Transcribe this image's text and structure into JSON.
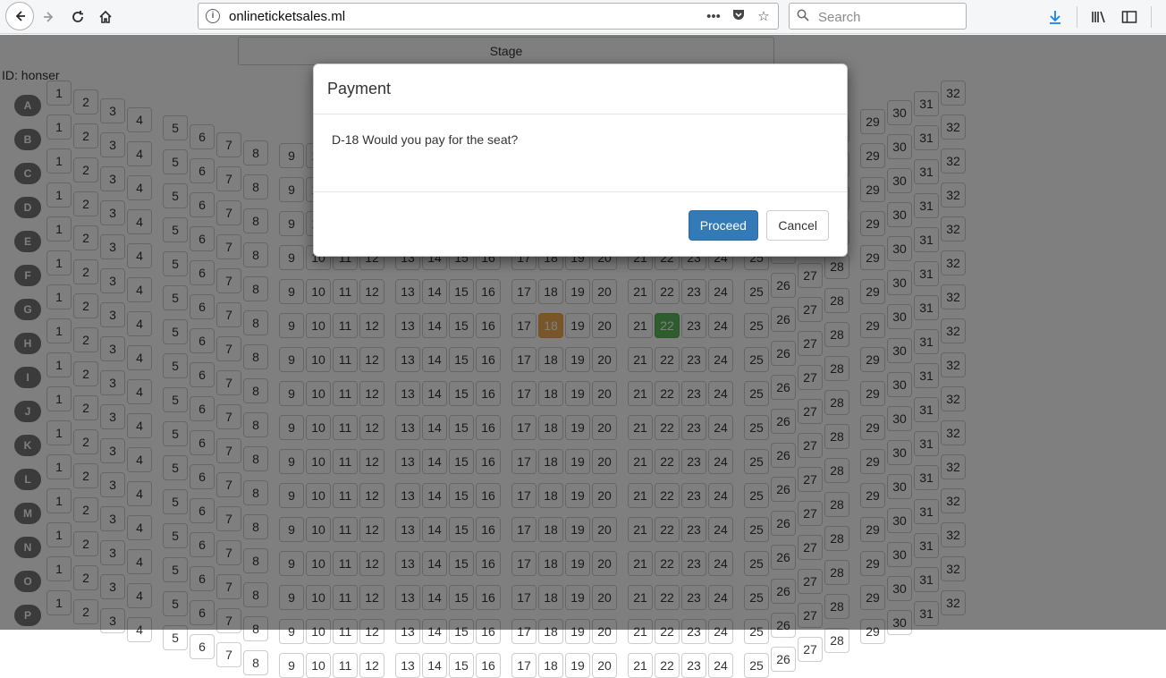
{
  "browser": {
    "url": "onlineticketsales.ml",
    "search_placeholder": "Search",
    "icons": [
      "back-icon",
      "forward-icon",
      "reload-icon",
      "home-icon",
      "info-icon",
      "page-actions-icon",
      "pocket-icon",
      "bookmark-star-icon",
      "download-icon",
      "library-icon",
      "sidebar-icon",
      "menu-icon"
    ]
  },
  "page": {
    "stage_label": "Stage",
    "user_id": "ID: honser"
  },
  "seatmap": {
    "rows": [
      "A",
      "B",
      "C",
      "D",
      "E",
      "F",
      "G",
      "H",
      "I",
      "J",
      "K",
      "L",
      "M",
      "N",
      "O",
      "P"
    ],
    "seat_count": 32,
    "selected": [
      {
        "row": "F",
        "seat": 18,
        "status": "sold"
      },
      {
        "row": "F",
        "seat": 22,
        "status": "reserved"
      }
    ]
  },
  "modal": {
    "title": "Payment",
    "message": "D-18 Would you pay for the seat?",
    "proceed_label": "Proceed",
    "cancel_label": "Cancel"
  },
  "colors": {
    "sold": "#f0ad4e",
    "reserved": "#5cb85c",
    "primary": "#337ab7"
  }
}
